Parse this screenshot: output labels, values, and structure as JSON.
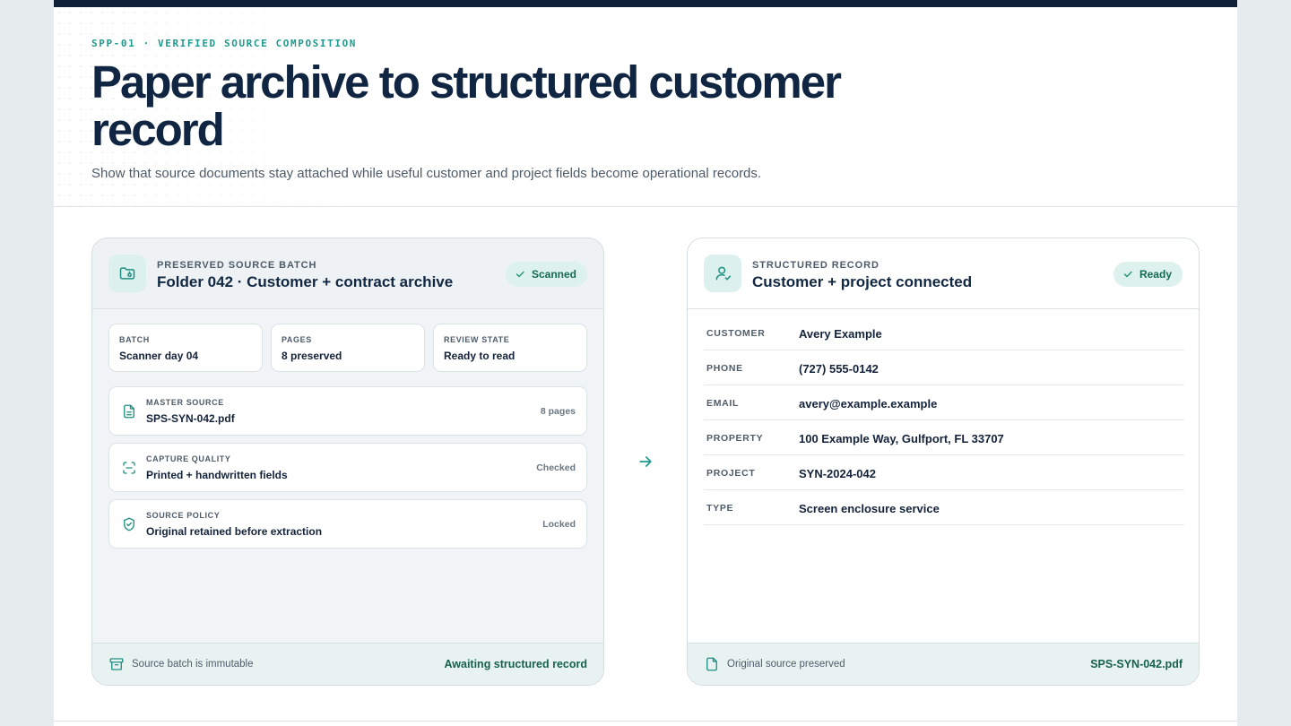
{
  "header": {
    "eyebrow": "SPP-01 · VERIFIED SOURCE COMPOSITION",
    "title": "Paper archive to structured customer record",
    "subtitle": "Show that source documents stay attached while useful customer and project fields become operational records."
  },
  "source_panel": {
    "eyebrow": "PRESERVED SOURCE BATCH",
    "title": "Folder 042 · Customer + contract archive",
    "badge": "Scanned",
    "stats": [
      {
        "label": "BATCH",
        "value": "Scanner day 04"
      },
      {
        "label": "PAGES",
        "value": "8 preserved"
      },
      {
        "label": "REVIEW STATE",
        "value": "Ready to read"
      }
    ],
    "rows": [
      {
        "label": "MASTER SOURCE",
        "value": "SPS-SYN-042.pdf",
        "status": "8 pages",
        "icon": "document-icon"
      },
      {
        "label": "CAPTURE QUALITY",
        "value": "Printed + handwritten fields",
        "status": "Checked",
        "icon": "scan-icon"
      },
      {
        "label": "SOURCE POLICY",
        "value": "Original retained before extraction",
        "status": "Locked",
        "icon": "shield-check-icon"
      }
    ],
    "footer": {
      "text": "Source batch is immutable",
      "status": "Awaiting structured record",
      "icon": "archive-box-icon"
    }
  },
  "record_panel": {
    "eyebrow": "STRUCTURED RECORD",
    "title": "Customer + project connected",
    "badge": "Ready",
    "fields": [
      {
        "key": "CUSTOMER",
        "value": "Avery Example"
      },
      {
        "key": "PHONE",
        "value": "(727) 555-0142"
      },
      {
        "key": "EMAIL",
        "value": "avery@example.example"
      },
      {
        "key": "PROPERTY",
        "value": "100 Example Way, Gulfport, FL 33707"
      },
      {
        "key": "PROJECT",
        "value": "SYN-2024-042"
      },
      {
        "key": "TYPE",
        "value": "Screen enclosure service"
      }
    ],
    "footer": {
      "text": "Original source preserved",
      "file": "SPS-SYN-042.pdf",
      "icon": "file-icon"
    }
  },
  "colors": {
    "accent": "#1f9a8e",
    "navy": "#0f2541",
    "badge_bg": "#ddf2ec",
    "footer_bg": "#e7f2f1"
  }
}
